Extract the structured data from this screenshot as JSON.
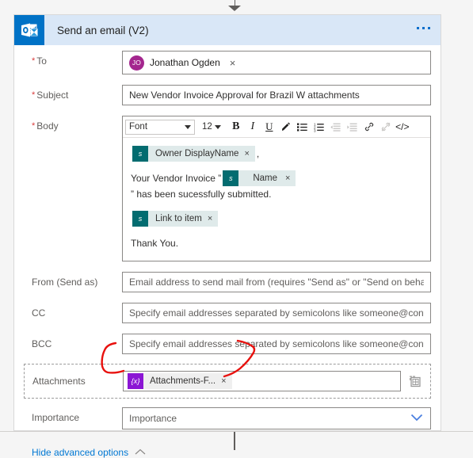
{
  "card": {
    "app_icon": "outlook-icon",
    "title": "Send an email (V2)",
    "overflow_menu": "..."
  },
  "fields": {
    "to": {
      "label": "To",
      "required": true,
      "recipient": {
        "initials": "JO",
        "name": "Jonathan Ogden",
        "remove": "×"
      }
    },
    "subject": {
      "label": "Subject",
      "required": true,
      "value": "New Vendor Invoice Approval for Brazil W attachments"
    },
    "body": {
      "label": "Body",
      "required": true,
      "toolbar": {
        "font_label": "Font",
        "size_label": "12",
        "bold": "B",
        "italic": "I",
        "underline": "U",
        "text_color": "✎",
        "bulleted_list": "bulleted-list",
        "numbered_list": "numbered-list",
        "indent": "indent",
        "outdent": "outdent",
        "link": "link",
        "unlink": "unlink",
        "code_view": "</>"
      },
      "content": {
        "line1_token": "Owner DisplayName",
        "line1_after": ",",
        "line2_before": "Your Vendor Invoice ”",
        "line2_token": "Name",
        "line2_after": "” has been sucessfully submitted.",
        "line3_token": "Link to item",
        "line4_text": "Thank You.",
        "token_remove": "×",
        "token_icon": "sharepoint-icon"
      }
    },
    "from": {
      "label": "From (Send as)",
      "placeholder": "Email address to send mail from (requires \"Send as\" or \"Send on behalf of\" permissions)"
    },
    "cc": {
      "label": "CC",
      "placeholder": "Specify email addresses separated by semicolons like someone@contoso.com"
    },
    "bcc": {
      "label": "BCC",
      "placeholder": "Specify email addresses separated by semicolons like someone@contoso.com"
    },
    "attachments": {
      "label": "Attachments",
      "token": "Attachments-F...",
      "token_icon": "expression-icon",
      "token_glyph": "{x}",
      "token_remove": "×",
      "array_toggle_icon": "switch-to-array-icon"
    },
    "importance": {
      "label": "Importance",
      "value": "Importance",
      "chevron_icon": "chevron-down-icon"
    }
  },
  "footer": {
    "toggle_label": "Hide advanced options",
    "toggle_icon": "chevron-up-icon"
  },
  "annotation": {
    "type": "handwritten-red-ink",
    "color": "#e8110e",
    "shape": "brackets-around-attachments-value"
  },
  "colors": {
    "header_bg": "#d9e7f7",
    "app_icon_bg": "#0072c6",
    "accent": "#0078d4",
    "required": "#d93b3b",
    "token_icon": "#036c70",
    "expression_icon": "#8b16d4",
    "avatar": "#a4268e"
  }
}
